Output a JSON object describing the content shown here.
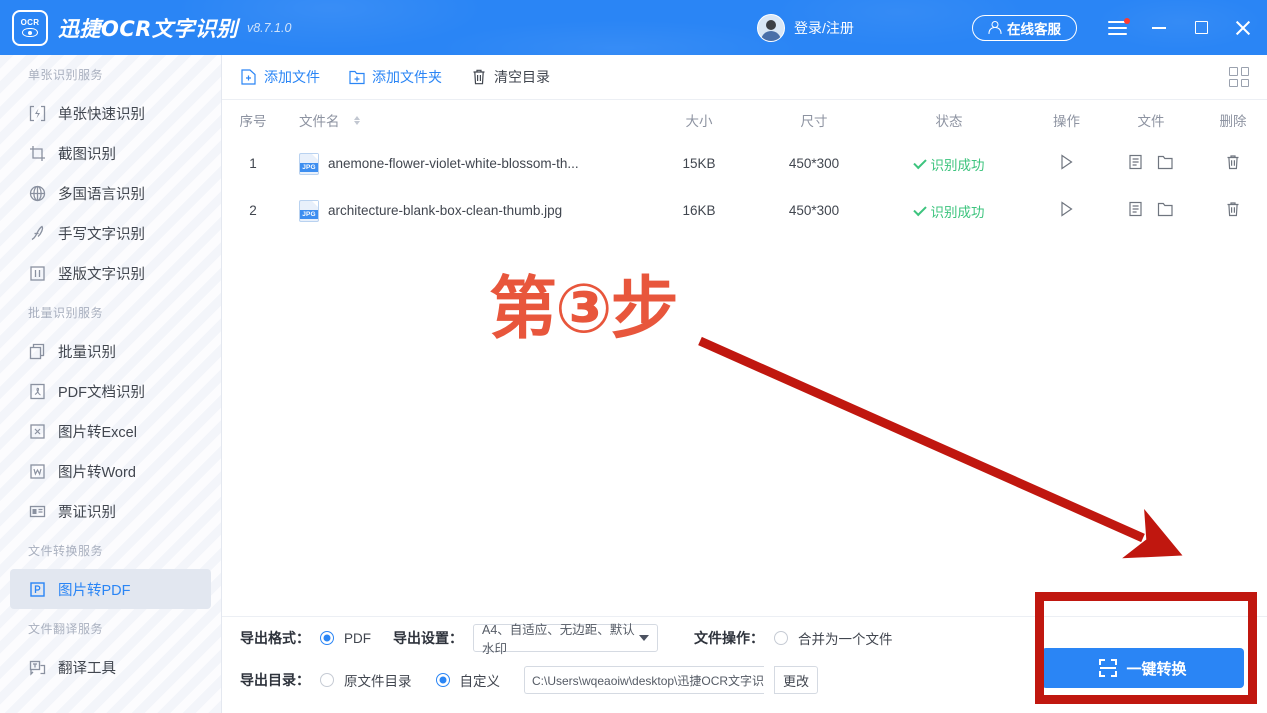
{
  "titlebar": {
    "logo_text": "OCR",
    "app_title": "迅捷OCR文字识别",
    "version": "v8.7.1.0",
    "login_label": "登录/注册",
    "online_service_label": "在线客服",
    "accent_color": "#2a85f5"
  },
  "sidebar": {
    "groups": [
      {
        "title": "单张识别服务",
        "items": [
          {
            "label": "单张快速识别",
            "icon": "quick-scan-icon",
            "active": false
          },
          {
            "label": "截图识别",
            "icon": "crop-icon",
            "active": false
          },
          {
            "label": "多国语言识别",
            "icon": "globe-icon",
            "active": false
          },
          {
            "label": "手写文字识别",
            "icon": "pen-icon",
            "active": false
          },
          {
            "label": "竖版文字识别",
            "icon": "vertical-text-icon",
            "active": false
          }
        ]
      },
      {
        "title": "批量识别服务",
        "items": [
          {
            "label": "批量识别",
            "icon": "copy-icon",
            "active": false
          },
          {
            "label": "PDF文档识别",
            "icon": "pdf-icon",
            "active": false
          },
          {
            "label": "图片转Excel",
            "icon": "excel-icon",
            "active": false
          },
          {
            "label": "图片转Word",
            "icon": "word-icon",
            "active": false
          },
          {
            "label": "票证识别",
            "icon": "card-icon",
            "active": false
          }
        ]
      },
      {
        "title": "文件转换服务",
        "items": [
          {
            "label": "图片转PDF",
            "icon": "pdf-convert-icon",
            "active": true
          }
        ]
      },
      {
        "title": "文件翻译服务",
        "items": [
          {
            "label": "翻译工具",
            "icon": "translate-icon",
            "active": false
          }
        ]
      }
    ]
  },
  "toolbar": {
    "add_file_label": "添加文件",
    "add_folder_label": "添加文件夹",
    "clear_list_label": "清空目录",
    "grid_view_icon": "grid-icon"
  },
  "table": {
    "headers": {
      "index": "序号",
      "filename": "文件名",
      "size": "大小",
      "dimension": "尺寸",
      "status": "状态",
      "action": "操作",
      "file": "文件",
      "delete": "删除"
    },
    "rows": [
      {
        "index": "1",
        "filetype": "JPG",
        "filename": "anemone-flower-violet-white-blossom-th...",
        "size": "15KB",
        "dimension": "450*300",
        "status": "识别成功"
      },
      {
        "index": "2",
        "filetype": "JPG",
        "filename": "architecture-blank-box-clean-thumb.jpg",
        "size": "16KB",
        "dimension": "450*300",
        "status": "识别成功"
      }
    ],
    "status_color": "#3dc47e"
  },
  "bottom": {
    "export_format_label": "导出格式：",
    "export_format_value": "PDF",
    "export_format_selected": true,
    "export_settings_label": "导出设置：",
    "export_settings_value": "A4、自适应、无边距、默认水印",
    "file_operation_label": "文件操作：",
    "merge_label": "合并为一个文件",
    "merge_selected": false,
    "export_dir_label": "导出目录：",
    "source_dir_label": "原文件目录",
    "source_dir_selected": false,
    "custom_dir_label": "自定义",
    "custom_dir_selected": true,
    "path_value": "C:\\Users\\wqeaoiw\\desktop\\迅捷OCR文字识",
    "change_label": "更改",
    "convert_label": "一键转换"
  },
  "annotations": {
    "step_text": "第③步",
    "annotation_color": "#e8563c",
    "arrow_color": "#c0170f",
    "highlight_box_color": "#c0170f"
  }
}
